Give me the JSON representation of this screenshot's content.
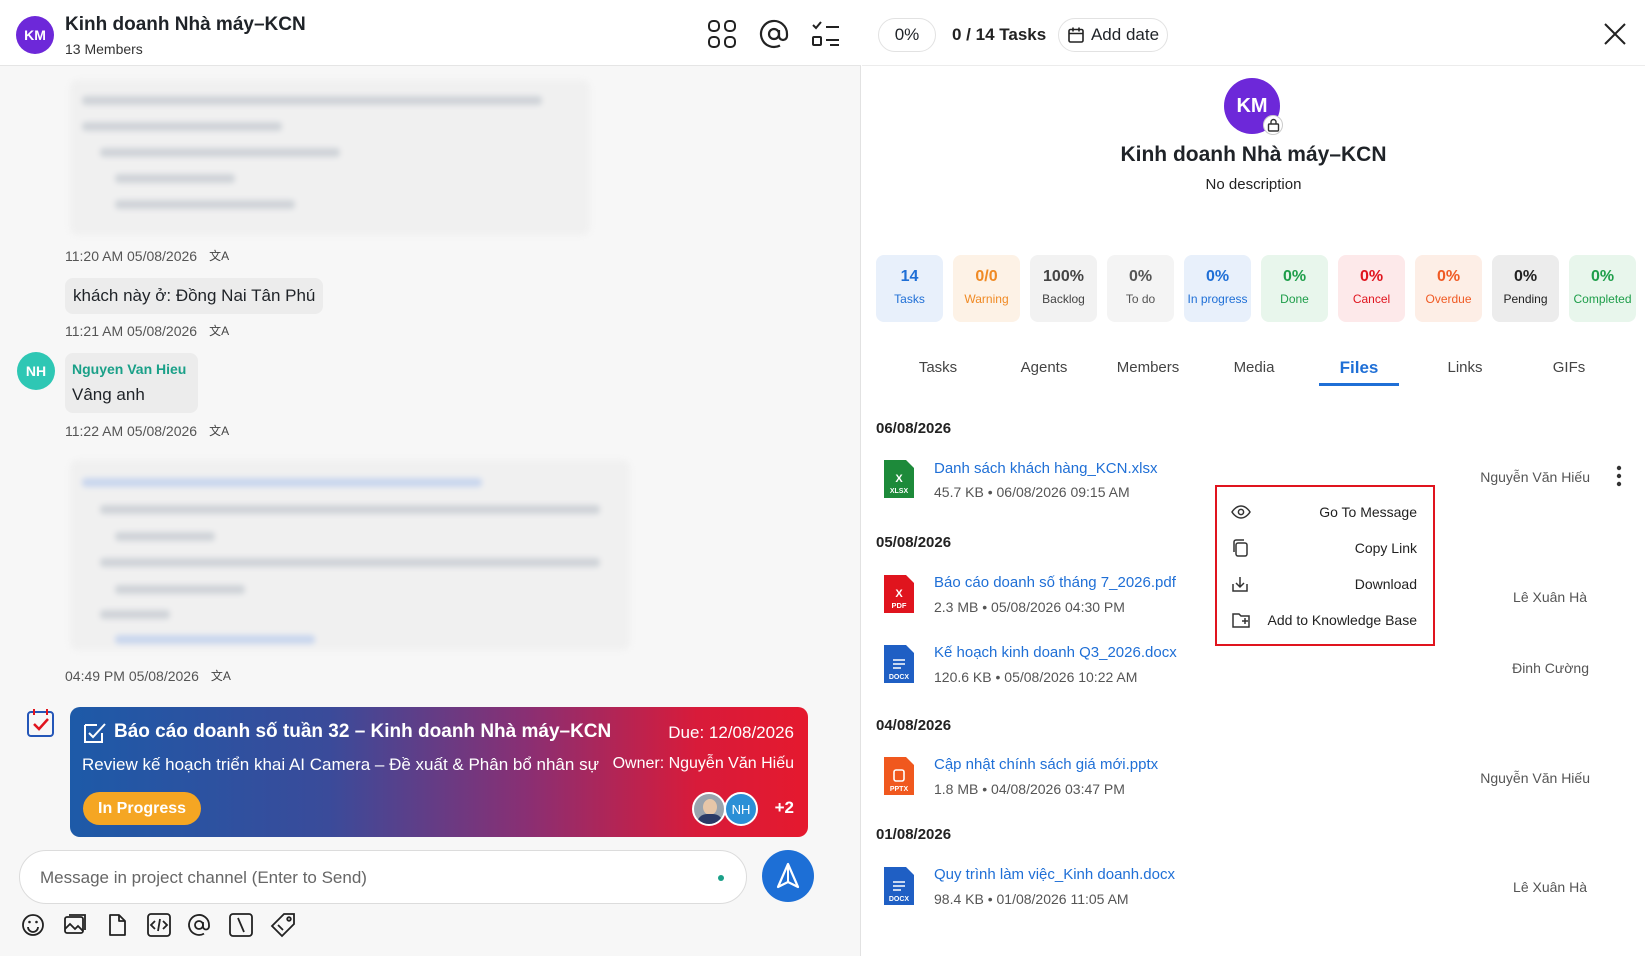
{
  "channel": {
    "avatar": "KM",
    "title": "Kinh doanh Nhà máy–KCN",
    "members": "13 Members",
    "icons": [
      "grid-icon",
      "mention-icon",
      "checklist-icon"
    ]
  },
  "messages": {
    "ts1": "11:20 AM 05/08/2026",
    "msg2": "khách này ở: Đồng Nai Tân Phú",
    "ts2": "11:21 AM 05/08/2026",
    "sender_avatar": "NH",
    "sender": "Nguyen Van Hieu",
    "msg3": "Vâng anh",
    "ts3": "11:22 AM 05/08/2026",
    "ts4": "04:49 PM 05/08/2026",
    "translate_icon": "文A"
  },
  "task_card": {
    "title": "Báo cáo doanh số tuần 32 – Kinh doanh Nhà máy–KCN",
    "due": "Due: 12/08/2026",
    "description": "Review kế hoạch triển khai AI Camera – Đề xuất & Phân bổ nhân sự",
    "owner": "Owner: Nguyễn Văn Hiếu",
    "status": "In Progress",
    "assignee_initials": "NH",
    "more": "+2",
    "colors": {
      "status": "#f5a623",
      "gradient_start": "#1d5aa8",
      "gradient_end": "#e5192e"
    }
  },
  "composer": {
    "placeholder": "Message in project channel (Enter to Send)",
    "tools": [
      "emoji-icon",
      "image-icon",
      "file-icon",
      "code-icon",
      "mention-icon",
      "slash-icon",
      "tag-icon"
    ]
  },
  "right_header": {
    "progress": "0%",
    "tasks": "0 / 14 Tasks",
    "add_date": "Add date"
  },
  "profile": {
    "avatar": "KM",
    "title": "Kinh doanh Nhà máy–KCN",
    "description": "No description"
  },
  "stats": [
    {
      "value": "14",
      "label": "Tasks",
      "color": "#1f6fd6",
      "bg": "#e8f0fb"
    },
    {
      "value": "0/0",
      "label": "Warning",
      "color": "#f08a24",
      "bg": "#fdf2e6"
    },
    {
      "value": "100%",
      "label": "Backlog",
      "color": "#444",
      "bg": "#f2f2f2"
    },
    {
      "value": "0%",
      "label": "To do",
      "color": "#555",
      "bg": "#f4f4f4"
    },
    {
      "value": "0%",
      "label": "In progress",
      "color": "#1f6fd6",
      "bg": "#e8f0fb"
    },
    {
      "value": "0%",
      "label": "Done",
      "color": "#1e9e4a",
      "bg": "#e8f6ec"
    },
    {
      "value": "0%",
      "label": "Cancel",
      "color": "#e0141e",
      "bg": "#fde9ea"
    },
    {
      "value": "0%",
      "label": "Overdue",
      "color": "#f05a24",
      "bg": "#fdeee6"
    },
    {
      "value": "0%",
      "label": "Pending",
      "color": "#222",
      "bg": "#ececec"
    },
    {
      "value": "0%",
      "label": "Completed",
      "color": "#1e9e4a",
      "bg": "#e8f6ec"
    }
  ],
  "tabs": [
    "Tasks",
    "Agents",
    "Members",
    "Media",
    "Files",
    "Links",
    "GIFs"
  ],
  "files": {
    "d1": "06/08/2026",
    "f1": {
      "name": "Danh sách khách hàng_KCN.xlsx",
      "meta": "45.7 KB  •  06/08/2026 09:15 AM",
      "owner": "Nguyễn Văn Hiếu",
      "type": "XLSX"
    },
    "d2": "05/08/2026",
    "f2": {
      "name": "Báo cáo doanh số tháng 7_2026.pdf",
      "meta": "2.3 MB  •  05/08/2026 04:30 PM",
      "owner": "Lê Xuân Hà",
      "type": "PDF"
    },
    "f3": {
      "name": "Kế hoạch kinh doanh Q3_2026.docx",
      "meta": "120.6 KB  •  05/08/2026 10:22 AM",
      "owner": "Đinh Cường",
      "type": "DOCX"
    },
    "d3": "04/08/2026",
    "f4": {
      "name": "Cập nhật chính sách giá mới.pptx",
      "meta": "1.8 MB  •  04/08/2026 03:47 PM",
      "owner": "Nguyễn Văn Hiếu",
      "type": "PPTX"
    },
    "d4": "01/08/2026",
    "f5": {
      "name": "Quy trình làm việc_Kinh doanh.docx",
      "meta": "98.4 KB  •  01/08/2026 11:05 AM",
      "owner": "Lê Xuân Hà",
      "type": "DOCX"
    }
  },
  "context_menu": {
    "go_to_message": "Go To Message",
    "copy_link": "Copy Link",
    "download": "Download",
    "add_kb": "Add to Knowledge Base"
  }
}
